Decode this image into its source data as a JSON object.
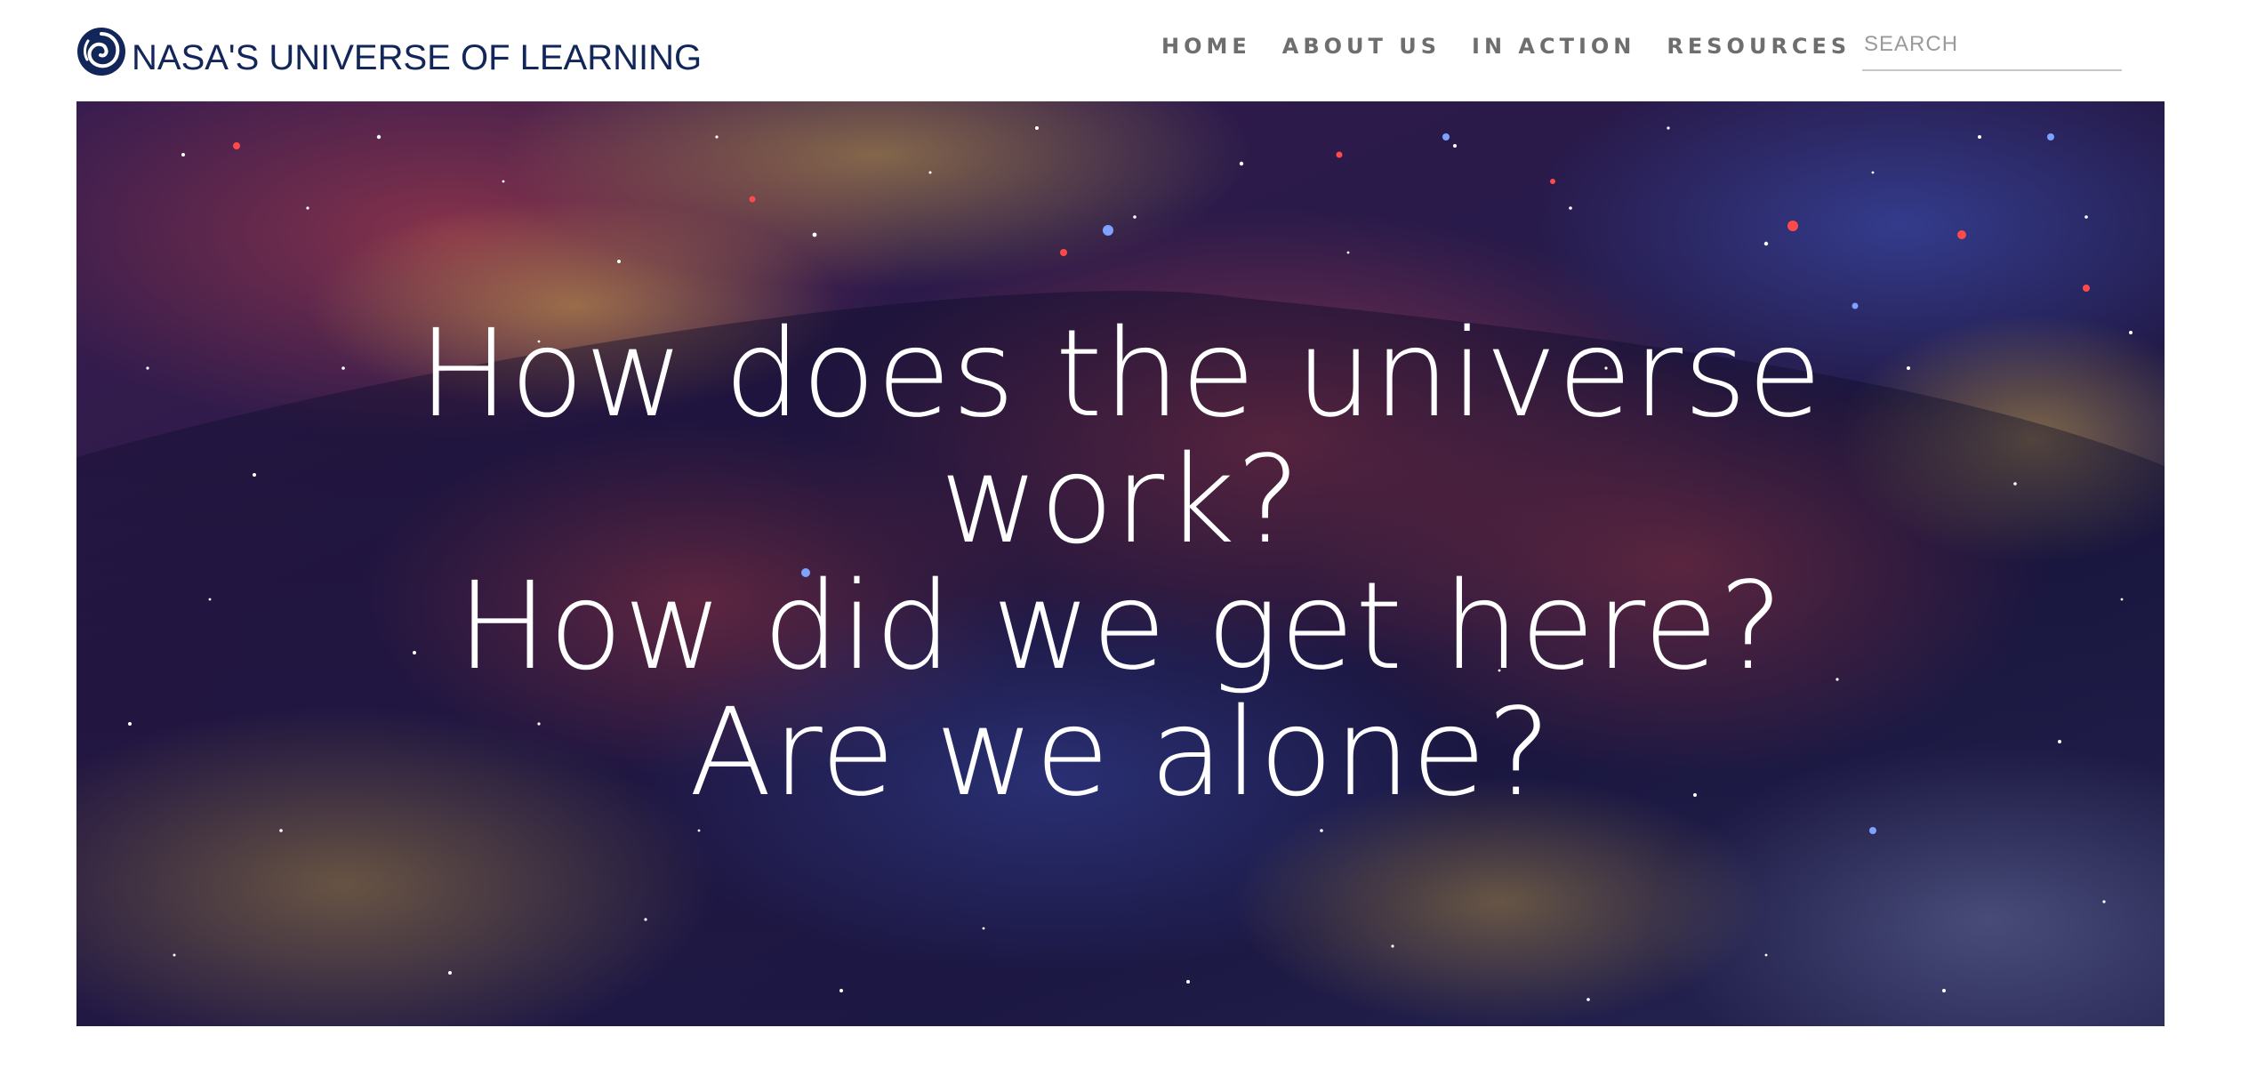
{
  "brand": {
    "name": "NASA'S UNIVERSE OF LEARNING",
    "logo_icon": "galaxy-spiral-icon",
    "color": "#12265a"
  },
  "nav": {
    "items": [
      {
        "label": "HOME"
      },
      {
        "label": "ABOUT US"
      },
      {
        "label": "IN ACTION"
      },
      {
        "label": "RESOURCES"
      }
    ],
    "color": "#6e6e6e"
  },
  "search": {
    "placeholder": "SEARCH",
    "value": ""
  },
  "hero": {
    "lines": [
      "How does the universe",
      "work?",
      "How did we get here?",
      "Are we alone?"
    ],
    "text_color": "#ffffff",
    "background": "galaxy-nebula-image"
  }
}
